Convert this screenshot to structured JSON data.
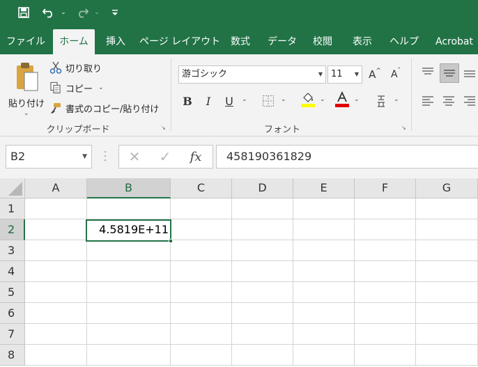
{
  "ribbon_tabs": [
    "ファイル",
    "ホーム",
    "挿入",
    "ページ レイアウト",
    "数式",
    "データ",
    "校閲",
    "表示",
    "ヘルプ",
    "Acrobat"
  ],
  "active_tab": "ホーム",
  "clipboard": {
    "paste_label": "貼り付け",
    "cut_label": "切り取り",
    "copy_label": "コピー",
    "format_painter_label": "書式のコピー/貼り付け",
    "group_label": "クリップボード"
  },
  "font": {
    "name": "游ゴシック",
    "size": "11",
    "group_label": "フォント",
    "bold_icon": "B",
    "italic_icon": "I",
    "underline_icon": "U",
    "fill_color": "#ffff00",
    "font_color": "#e00000"
  },
  "formula_bar": {
    "name_box": "B2",
    "cancel_icon": "✕",
    "enter_icon": "✓",
    "fx_label": "fx",
    "value": "458190361829"
  },
  "grid": {
    "columns": [
      "A",
      "B",
      "C",
      "D",
      "E",
      "F",
      "G"
    ],
    "rows": [
      "1",
      "2",
      "3",
      "4",
      "5",
      "6",
      "7",
      "8"
    ],
    "selected_column": "B",
    "selected_row": "2",
    "cells": {
      "B2": "4.5819E+11"
    }
  },
  "theme": {
    "accent": "#217346"
  }
}
